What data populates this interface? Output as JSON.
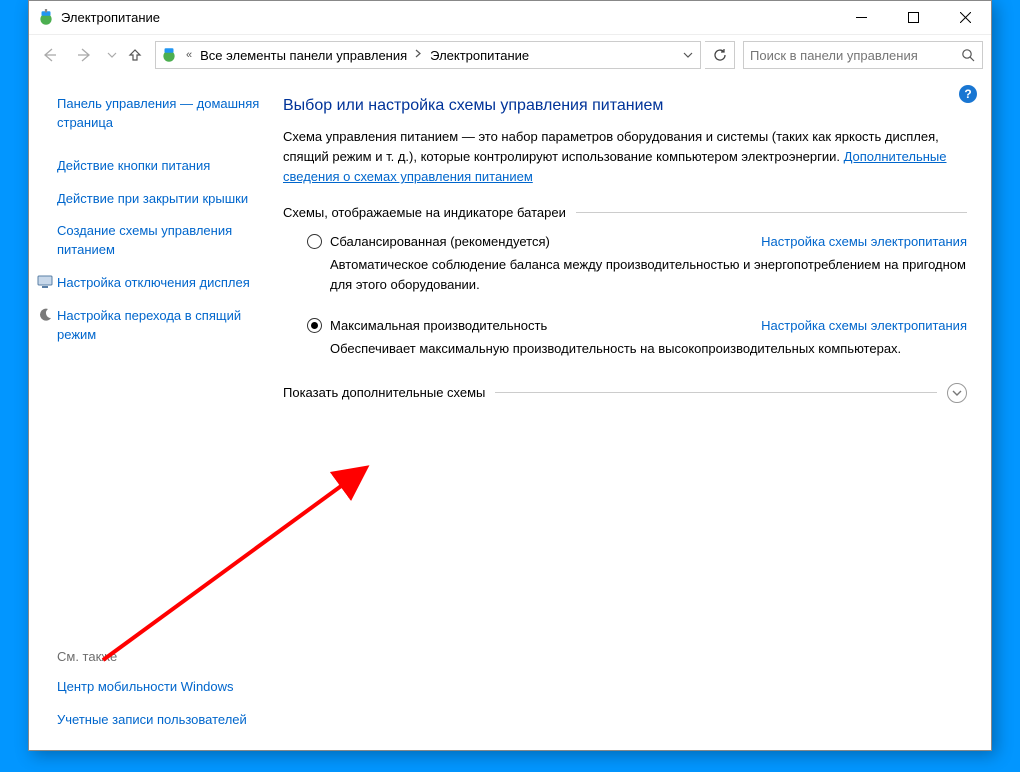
{
  "window": {
    "title": "Электропитание"
  },
  "breadcrumb": {
    "prefix": "«",
    "parent": "Все элементы панели управления",
    "current": "Электропитание"
  },
  "search": {
    "placeholder": "Поиск в панели управления"
  },
  "sidebar": {
    "home": "Панель управления — домашняя страница",
    "links": [
      {
        "label": "Действие кнопки питания"
      },
      {
        "label": "Действие при закрытии крышки"
      },
      {
        "label": "Создание схемы управления питанием"
      },
      {
        "label": "Настройка отключения дисплея",
        "icon": "monitor-icon"
      },
      {
        "label": "Настройка перехода в спящий режим",
        "icon": "moon-icon"
      }
    ],
    "see_also_heading": "См. также",
    "see_also": [
      {
        "label": "Центр мобильности Windows"
      },
      {
        "label": "Учетные записи пользователей"
      }
    ]
  },
  "help": {
    "glyph": "?"
  },
  "main": {
    "heading": "Выбор или настройка схемы управления питанием",
    "intro_pre": "Схема управления питанием — это набор параметров оборудования и системы (таких как яркость дисплея, спящий режим и т. д.), которые контролируют использование компьютером электроэнергии. ",
    "intro_link": "Дополнительные сведения о схемах управления питанием",
    "group_label": "Схемы, отображаемые на индикаторе батареи",
    "plans": [
      {
        "name": "Сбалансированная (рекомендуется)",
        "desc": "Автоматическое соблюдение баланса между производительностью и энергопотреблением на пригодном для этого оборудовании.",
        "config": "Настройка схемы электропитания",
        "selected": false
      },
      {
        "name": "Максимальная производительность",
        "desc": "Обеспечивает максимальную производительность на высокопроизводительных компьютерах.",
        "config": "Настройка схемы электропитания",
        "selected": true
      }
    ],
    "expand_label": "Показать дополнительные схемы"
  }
}
